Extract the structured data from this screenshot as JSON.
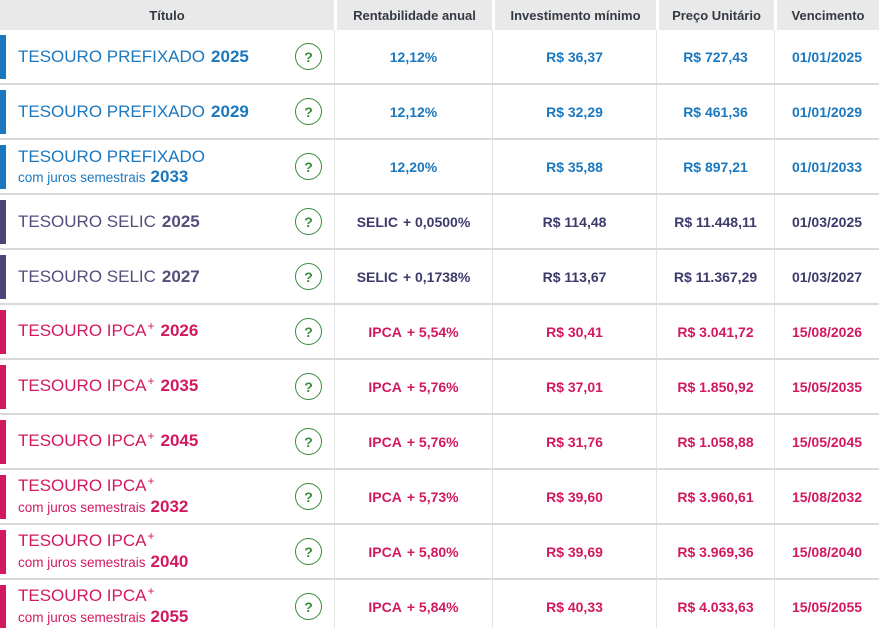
{
  "colors": {
    "blue": "#1b78bf",
    "purple_bar": "#4e4577",
    "purple_title": "#534e7c",
    "purple_value": "#3c3a6b",
    "pink": "#d2195f",
    "green": "#3a8a3e",
    "header_bg": "#e9e9e9",
    "header_text": "#333a41",
    "row_border": "#d9d9d9",
    "col_border": "#e4e4e4"
  },
  "icons": {
    "help_glyph": "?"
  },
  "table": {
    "columns": [
      "Título",
      "Rentabilidade anual",
      "Investimento mínimo",
      "Preço Unitário",
      "Vencimento"
    ],
    "rows": [
      {
        "theme": "blue",
        "title": {
          "line1": "TESOURO PREFIXADO",
          "sup": "",
          "line1_year": "2025",
          "line2": "",
          "line2_year": ""
        },
        "rate": {
          "prefix": "",
          "value": "12,12%"
        },
        "min_investment": "R$ 36,37",
        "unit_price": "R$ 727,43",
        "maturity": "01/01/2025"
      },
      {
        "theme": "blue",
        "title": {
          "line1": "TESOURO PREFIXADO",
          "sup": "",
          "line1_year": "2029",
          "line2": "",
          "line2_year": ""
        },
        "rate": {
          "prefix": "",
          "value": "12,12%"
        },
        "min_investment": "R$ 32,29",
        "unit_price": "R$ 461,36",
        "maturity": "01/01/2029"
      },
      {
        "theme": "blue",
        "title": {
          "line1": "TESOURO PREFIXADO",
          "sup": "",
          "line1_year": "",
          "line2": "com juros semestrais",
          "line2_year": "2033"
        },
        "rate": {
          "prefix": "",
          "value": "12,20%"
        },
        "min_investment": "R$ 35,88",
        "unit_price": "R$ 897,21",
        "maturity": "01/01/2033"
      },
      {
        "theme": "purple",
        "title": {
          "line1": "TESOURO SELIC",
          "sup": "",
          "line1_year": "2025",
          "line2": "",
          "line2_year": ""
        },
        "rate": {
          "prefix": "SELIC",
          "value": "+ 0,0500%"
        },
        "min_investment": "R$ 114,48",
        "unit_price": "R$ 11.448,11",
        "maturity": "01/03/2025"
      },
      {
        "theme": "purple",
        "title": {
          "line1": "TESOURO SELIC",
          "sup": "",
          "line1_year": "2027",
          "line2": "",
          "line2_year": ""
        },
        "rate": {
          "prefix": "SELIC",
          "value": "+ 0,1738%"
        },
        "min_investment": "R$ 113,67",
        "unit_price": "R$ 11.367,29",
        "maturity": "01/03/2027"
      },
      {
        "theme": "pink",
        "title": {
          "line1": "TESOURO IPCA",
          "sup": "+",
          "line1_year": "2026",
          "line2": "",
          "line2_year": ""
        },
        "rate": {
          "prefix": "IPCA",
          "value": "+ 5,54%"
        },
        "min_investment": "R$ 30,41",
        "unit_price": "R$ 3.041,72",
        "maturity": "15/08/2026"
      },
      {
        "theme": "pink",
        "title": {
          "line1": "TESOURO IPCA",
          "sup": "+",
          "line1_year": "2035",
          "line2": "",
          "line2_year": ""
        },
        "rate": {
          "prefix": "IPCA",
          "value": "+ 5,76%"
        },
        "min_investment": "R$ 37,01",
        "unit_price": "R$ 1.850,92",
        "maturity": "15/05/2035"
      },
      {
        "theme": "pink",
        "title": {
          "line1": "TESOURO IPCA",
          "sup": "+",
          "line1_year": "2045",
          "line2": "",
          "line2_year": ""
        },
        "rate": {
          "prefix": "IPCA",
          "value": "+ 5,76%"
        },
        "min_investment": "R$ 31,76",
        "unit_price": "R$ 1.058,88",
        "maturity": "15/05/2045"
      },
      {
        "theme": "pink",
        "title": {
          "line1": "TESOURO IPCA",
          "sup": "+",
          "line1_year": "",
          "line2": "com juros semestrais",
          "line2_year": "2032"
        },
        "rate": {
          "prefix": "IPCA",
          "value": "+ 5,73%"
        },
        "min_investment": "R$ 39,60",
        "unit_price": "R$ 3.960,61",
        "maturity": "15/08/2032"
      },
      {
        "theme": "pink",
        "title": {
          "line1": "TESOURO IPCA",
          "sup": "+",
          "line1_year": "",
          "line2": "com juros semestrais",
          "line2_year": "2040"
        },
        "rate": {
          "prefix": "IPCA",
          "value": "+ 5,80%"
        },
        "min_investment": "R$ 39,69",
        "unit_price": "R$ 3.969,36",
        "maturity": "15/08/2040"
      },
      {
        "theme": "pink",
        "title": {
          "line1": "TESOURO IPCA",
          "sup": "+",
          "line1_year": "",
          "line2": "com juros semestrais",
          "line2_year": "2055"
        },
        "rate": {
          "prefix": "IPCA",
          "value": "+ 5,84%"
        },
        "min_investment": "R$ 40,33",
        "unit_price": "R$ 4.033,63",
        "maturity": "15/05/2055"
      }
    ]
  }
}
